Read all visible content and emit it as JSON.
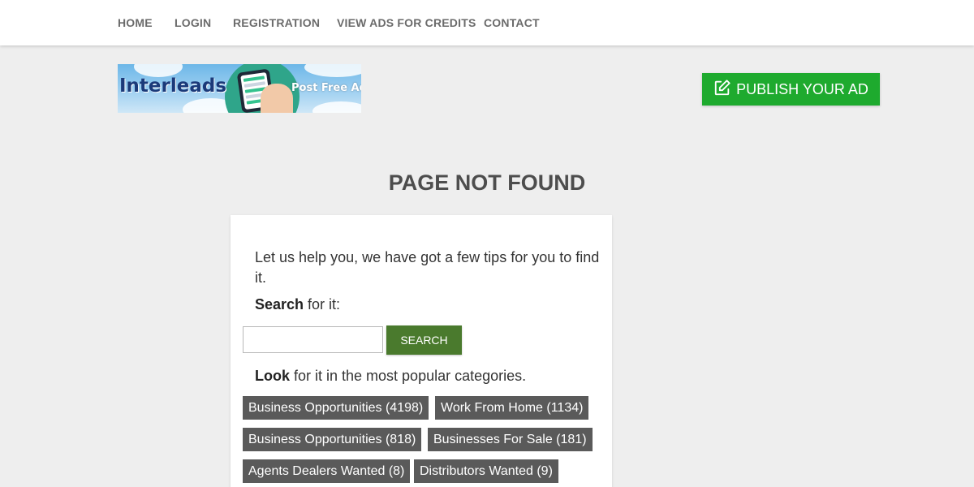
{
  "nav": {
    "items": [
      {
        "label": "HOME"
      },
      {
        "label": "LOGIN"
      },
      {
        "label": "REGISTRATION"
      },
      {
        "label": "VIEW ADS FOR CREDITS"
      },
      {
        "label": "CONTACT"
      }
    ]
  },
  "logo": {
    "brand": "Interleads",
    "tagline": "Post Free Ads"
  },
  "publish_button": {
    "label": "PUBLISH YOUR AD",
    "icon": "edit-icon",
    "color": "#1eaa2e"
  },
  "main": {
    "title": "PAGE NOT FOUND",
    "tips": "Let us help you, we have got a few tips for you to find it.",
    "search_bold": "Search",
    "search_rest": " for it:",
    "search_input_value": "",
    "search_button": "SEARCH",
    "look_bold": "Look",
    "look_rest": " for it in the most popular categories.",
    "categories": [
      {
        "label": "Business Opportunities (4198)"
      },
      {
        "label": "Work From Home (1134)"
      },
      {
        "label": "Business Opportunities (818)"
      },
      {
        "label": "Businesses For Sale (181)"
      },
      {
        "label": "Agents Dealers Wanted (8)"
      },
      {
        "label": "Distributors Wanted (9)"
      }
    ]
  },
  "colors": {
    "background": "#eeeeee",
    "nav_text": "#6b6b6b",
    "search_button": "#4a7a2d",
    "category_chip": "#5a5a5a"
  }
}
